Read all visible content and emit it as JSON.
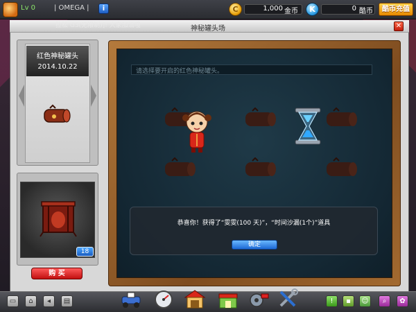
{
  "topbar": {
    "level": "Lv 0",
    "player_name": "| OMEGA |",
    "info_label": "i",
    "coin_value": "1,000",
    "coin_label": "金币",
    "kcoin_value": "0",
    "kcoin_label": "酷币",
    "recharge_label": "酷币充值"
  },
  "marquee": "拉松  G3(无限制)]!  大家加油哦",
  "window": {
    "title": "神秘罐头场",
    "close_label": "✕"
  },
  "item": {
    "name": "红色神秘罐头",
    "date": "2014.10.22",
    "count": "18",
    "buy_label": "购  买"
  },
  "board": {
    "hint": "请选择要开启的红色神秘罐头。",
    "dialog_text": "恭喜你！获得了“雯雯(100 天)”，“时间沙漏(1个)”道具",
    "confirm_label": "确定"
  },
  "bottombar": {
    "left_buttons": [
      "screen-icon",
      "home-icon",
      "back-icon",
      "folder-icon"
    ],
    "center_icons": [
      "kart-icon",
      "speedometer-icon",
      "garage-icon",
      "shop-icon",
      "workshop-icon",
      "tools-icon"
    ],
    "right_buttons": [
      "alert-icon",
      "chat-icon",
      "friends-icon",
      "search-icon",
      "settings-icon"
    ]
  },
  "colors": {
    "board": "#142834",
    "frame": "#8a5523",
    "accent_gold": "#e9a10a",
    "accent_blue": "#1c68d4",
    "buy_red": "#c21010"
  }
}
